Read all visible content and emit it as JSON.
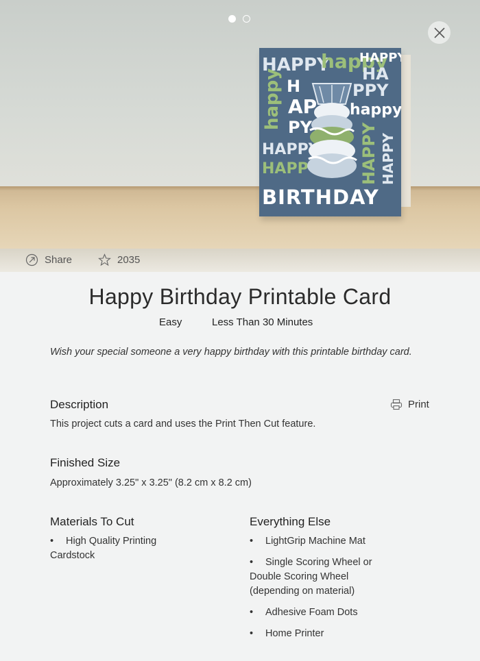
{
  "hero": {
    "card_words": {
      "happy": "HAPPY",
      "happy_lower": "happy",
      "happy_partial": "HA",
      "ppy": "PPY",
      "ap": "AP",
      "h": "H",
      "py": "PY",
      "birthday": "BIRTHDAY"
    }
  },
  "meta": {
    "share_label": "Share",
    "favorites_count": "2035"
  },
  "project": {
    "title": "Happy Birthday Printable Card",
    "difficulty": "Easy",
    "time": "Less Than 30 Minutes",
    "intro": "Wish your special someone a very happy birthday with this printable birthday card."
  },
  "description": {
    "heading": "Description",
    "print_label": "Print",
    "text": "This project cuts a card and uses the Print Then Cut feature."
  },
  "finished_size": {
    "heading": "Finished Size",
    "text": "Approximately 3.25\" x 3.25\" (8.2 cm x 8.2 cm)"
  },
  "materials": {
    "heading": "Materials To Cut",
    "items": [
      "High Quality Printing Cardstock"
    ]
  },
  "everything_else": {
    "heading": "Everything Else",
    "items": [
      "LightGrip Machine Mat",
      "Single Scoring Wheel or Double Scoring Wheel (depending on material)",
      "Adhesive Foam Dots",
      "Home Printer"
    ]
  },
  "colors": {
    "card_blue": "#4f6a86",
    "card_green": "#9cbf7a",
    "page_bg": "#f2f3f3"
  }
}
